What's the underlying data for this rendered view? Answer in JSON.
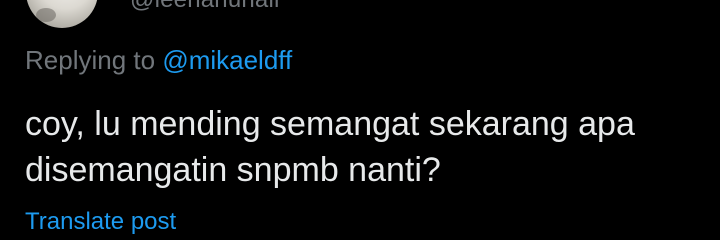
{
  "author": {
    "handle": "@leenanunair"
  },
  "reply": {
    "prefix": "Replying to",
    "mention": "@mikaeldff"
  },
  "post": {
    "lines": [
      "coy, lu mending semangat sekarang apa",
      "disemangatin snpmb nanti?"
    ]
  },
  "actions": {
    "translate_label": "Translate post"
  },
  "colors": {
    "background": "#000000",
    "text": "#e7e9ea",
    "muted": "#71767b",
    "accent": "#1d9bf0"
  }
}
